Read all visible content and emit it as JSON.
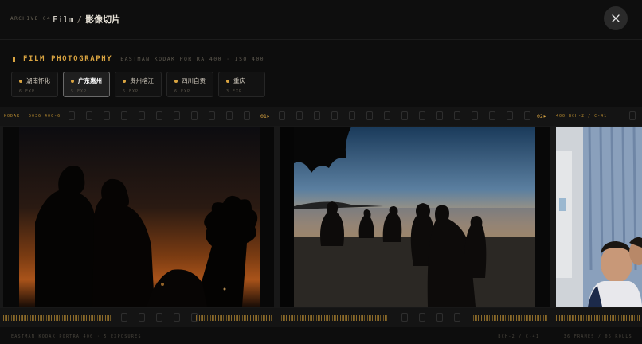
{
  "header": {
    "archive": "ARCHIVE 04",
    "crumb_root": "Film",
    "crumb_sep": "/",
    "crumb_current": "影像切片"
  },
  "section": {
    "title": "FILM PHOTOGRAPHY",
    "subtitle": "EASTMAN KODAK PORTRA 400 · ISO 400"
  },
  "tabs": [
    {
      "name": "湖南怀化",
      "exp": "6 EXP",
      "active": false
    },
    {
      "name": "广东惠州",
      "exp": "5 EXP",
      "active": true
    },
    {
      "name": "贵州榕江",
      "exp": "6 EXP",
      "active": false
    },
    {
      "name": "四川自贡",
      "exp": "6 EXP",
      "active": false
    },
    {
      "name": "重庆",
      "exp": "3 EXP",
      "active": false
    }
  ],
  "strip": {
    "edge_left": "KODAK",
    "edge_code": "5036 400-6",
    "marker_1": "01▸",
    "marker_2": "02▸",
    "edge_right": "400 BCH-2 / C-41"
  },
  "footer": {
    "left": "EASTMAN KODAK PORTRA 400 · 5 EXPOSURES",
    "right_1": "BCH-2 / C-41",
    "right_2": "36 FRAMES / 05 ROLLS"
  },
  "colors": {
    "accent": "#d9a441",
    "background": "#0d0d0d"
  },
  "icons": {
    "close": "close-icon"
  }
}
